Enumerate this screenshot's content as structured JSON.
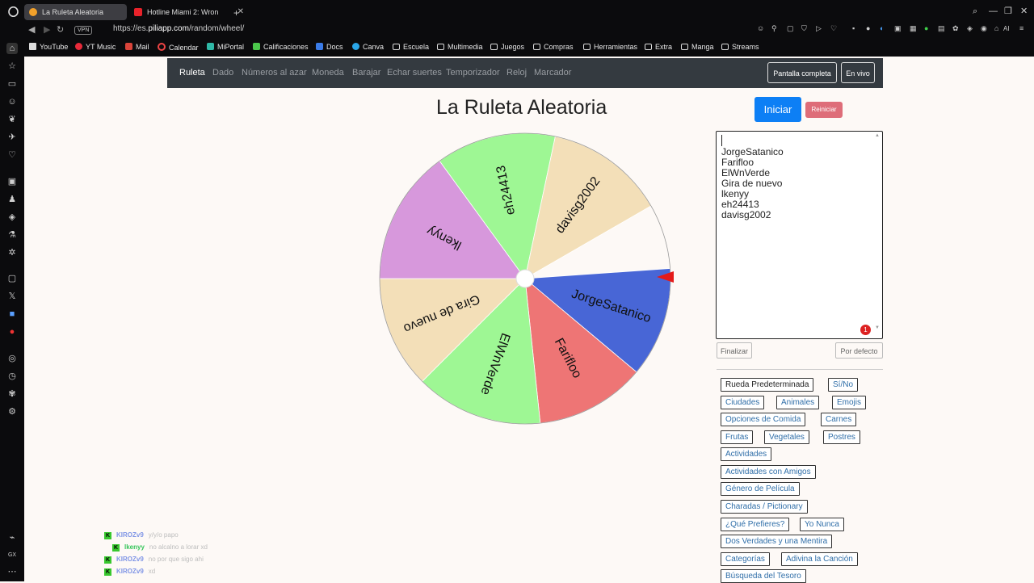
{
  "browser": {
    "tabs": [
      {
        "label": "La Ruleta Aleatoria",
        "active": true
      },
      {
        "label": "Hotline Miami 2: Wron",
        "active": false
      }
    ],
    "new_tab": "+",
    "vpn": "VPN",
    "url_prefix": "https://es.",
    "url_domain": "piliapp.com",
    "url_path": "/random/wheel/",
    "ai_label": "AI",
    "bookmarks": [
      "YouTube",
      "YT Music",
      "Mail",
      "Calendar",
      "MiPortal",
      "Calificaciones",
      "Docs",
      "Canva",
      "Escuela",
      "Multimedia",
      "Juegos",
      "Compras",
      "Herramientas",
      "Extra",
      "Manga",
      "Streams"
    ],
    "sidebar_gx": "GX"
  },
  "navbar": {
    "links": [
      "Ruleta",
      "Dado",
      "Números al azar",
      "Moneda",
      "Barajar",
      "Echar suertes",
      "Temporizador",
      "Reloj",
      "Marcador"
    ],
    "fullscreen": "Pantalla completa",
    "live": "En vivo"
  },
  "page": {
    "title": "La Ruleta Aleatoria",
    "start_button": "Iniciar",
    "reset_button": "Reiniciar"
  },
  "wheel": {
    "segments": [
      {
        "label": "JorgeSatanico",
        "color": "#4866d6"
      },
      {
        "label": "Farifloo",
        "color": "#ee7575"
      },
      {
        "label": "ElWnVerde",
        "color": "#9ef794"
      },
      {
        "label": "Gira de nuevo",
        "color": "#f3dfb8"
      },
      {
        "label": "lkenyy",
        "color": "#d798dc"
      },
      {
        "label": "eh24413",
        "color": "#9ef794"
      },
      {
        "label": "davisg2002",
        "color": "#f3dfb8"
      }
    ],
    "pointer_color": "#e41a1a"
  },
  "names_list": {
    "lines": [
      "JorgeSatanico",
      "Farifloo",
      "ElWnVerde",
      "Gira de nuevo",
      "lkenyy",
      "eh24413",
      "davisg2002"
    ],
    "badge": "1",
    "finish_button": "Finalizar",
    "default_button": "Por defecto"
  },
  "presets": [
    "Rueda Predeterminada",
    "Sí/No",
    "Ciudades",
    "Animales",
    "Emojis",
    "Opciones de Comida",
    "Carnes",
    "Frutas",
    "Vegetales",
    "Postres",
    "Actividades",
    "Actividades con Amigos",
    "Género de Película",
    "Charadas / Pictionary",
    "¿Qué Prefieres?",
    "Yo Nunca",
    "Dos Verdades y una Mentira",
    "Categorías",
    "Adivina la Canción",
    "Búsqueda del Tesoro"
  ],
  "chat": [
    {
      "user": "KIROZv9",
      "message": "y/y/o papo",
      "color": "#7f95e6"
    },
    {
      "user": "lkenyy",
      "message": "no alcalno a lorar xd",
      "color": "#35c55a"
    },
    {
      "user": "KIROZv9",
      "message": "no por que sigo ahi",
      "color": "#7f95e6"
    },
    {
      "user": "KIROZv9",
      "message": "xd",
      "color": "#7f95e6"
    }
  ]
}
